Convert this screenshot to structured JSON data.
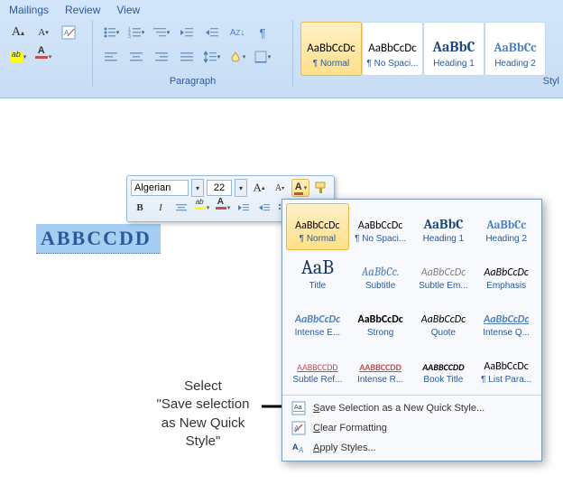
{
  "tabs": {
    "mailings": "Mailings",
    "review": "Review",
    "view": "View"
  },
  "groups": {
    "paragraph": "Paragraph",
    "styles": "Styl"
  },
  "ribbon_styles": [
    {
      "preview": "AaBbCcDc",
      "label": "¶ Normal",
      "style": "font-family:Calibri;color:#000",
      "selected": true
    },
    {
      "preview": "AaBbCcDc",
      "label": "¶ No Spaci...",
      "style": "font-family:Calibri;color:#000",
      "selected": false
    },
    {
      "preview": "AaBbC",
      "label": "Heading 1",
      "style": "font-family:Cambria;color:#1f497d;font-weight:bold;font-size:16px",
      "selected": false
    },
    {
      "preview": "AaBbCc",
      "label": "Heading 2",
      "style": "font-family:Cambria;color:#4f81bd;font-weight:bold;font-size:14px",
      "selected": false
    }
  ],
  "mini": {
    "font": "Algerian",
    "size": "22",
    "bold": "B",
    "italic": "I"
  },
  "doc_text": "ABBCCDD",
  "popup_styles": [
    {
      "preview": "AaBbCcDc",
      "label": "¶ Normal",
      "style": "font-family:Calibri;color:#000",
      "selected": true
    },
    {
      "preview": "AaBbCcDc",
      "label": "¶ No Spaci...",
      "style": "font-family:Calibri;color:#000",
      "selected": false
    },
    {
      "preview": "AaBbC",
      "label": "Heading 1",
      "style": "font-family:Cambria;color:#1f497d;font-weight:bold;font-size:15px",
      "selected": false
    },
    {
      "preview": "AaBbCc",
      "label": "Heading 2",
      "style": "font-family:Cambria;color:#4f81bd;font-weight:bold;font-size:13px",
      "selected": false
    },
    {
      "preview": "AaB",
      "label": "Title",
      "style": "font-family:Cambria;color:#17365d;font-size:22px",
      "selected": false
    },
    {
      "preview": "AaBbCc.",
      "label": "Subtitle",
      "style": "font-family:Cambria;color:#4f81bd;font-style:italic;font-size:13px",
      "selected": false
    },
    {
      "preview": "AaBbCcDc",
      "label": "Subtle Em...",
      "style": "font-family:Calibri;color:#808080;font-style:italic",
      "selected": false
    },
    {
      "preview": "AaBbCcDc",
      "label": "Emphasis",
      "style": "font-family:Calibri;color:#000;font-style:italic",
      "selected": false
    },
    {
      "preview": "AaBbCcDc",
      "label": "Intense E...",
      "style": "font-family:Calibri;color:#4f81bd;font-style:italic;font-weight:bold",
      "selected": false
    },
    {
      "preview": "AaBbCcDc",
      "label": "Strong",
      "style": "font-family:Calibri;color:#000;font-weight:bold",
      "selected": false
    },
    {
      "preview": "AaBbCcDc",
      "label": "Quote",
      "style": "font-family:Calibri;color:#000;font-style:italic",
      "selected": false
    },
    {
      "preview": "AaBbCcDc",
      "label": "Intense Q...",
      "style": "font-family:Calibri;color:#4f81bd;font-style:italic;font-weight:bold;text-decoration:underline",
      "selected": false
    },
    {
      "preview": "AABBCCDD",
      "label": "Subtle Ref...",
      "style": "font-family:Calibri;color:#c0504d;font-size:10px;text-decoration:underline",
      "selected": false
    },
    {
      "preview": "AABBCCDD",
      "label": "Intense R...",
      "style": "font-family:Calibri;color:#c0504d;font-weight:bold;font-size:10px;text-decoration:underline",
      "selected": false
    },
    {
      "preview": "AABBCCDD",
      "label": "Book Title",
      "style": "font-family:Calibri;color:#000;font-weight:bold;font-size:10px;font-style:italic",
      "selected": false
    },
    {
      "preview": "AaBbCcDc",
      "label": "¶ List Para...",
      "style": "font-family:Calibri;color:#000",
      "selected": false
    }
  ],
  "popup_items": {
    "save_new": "Save Selection as a New Quick Style...",
    "clear": "Clear Formatting",
    "apply": "Apply Styles...",
    "save_key": "S",
    "clear_key": "C",
    "apply_key": "A"
  },
  "instruction": {
    "l1": "Select",
    "l2": "\"Save selection",
    "l3": "as New Quick",
    "l4": "Style\""
  },
  "colors": {
    "accent": "#c0504d",
    "fontcolor": "#c0504d",
    "highlight": "#ffff00"
  }
}
